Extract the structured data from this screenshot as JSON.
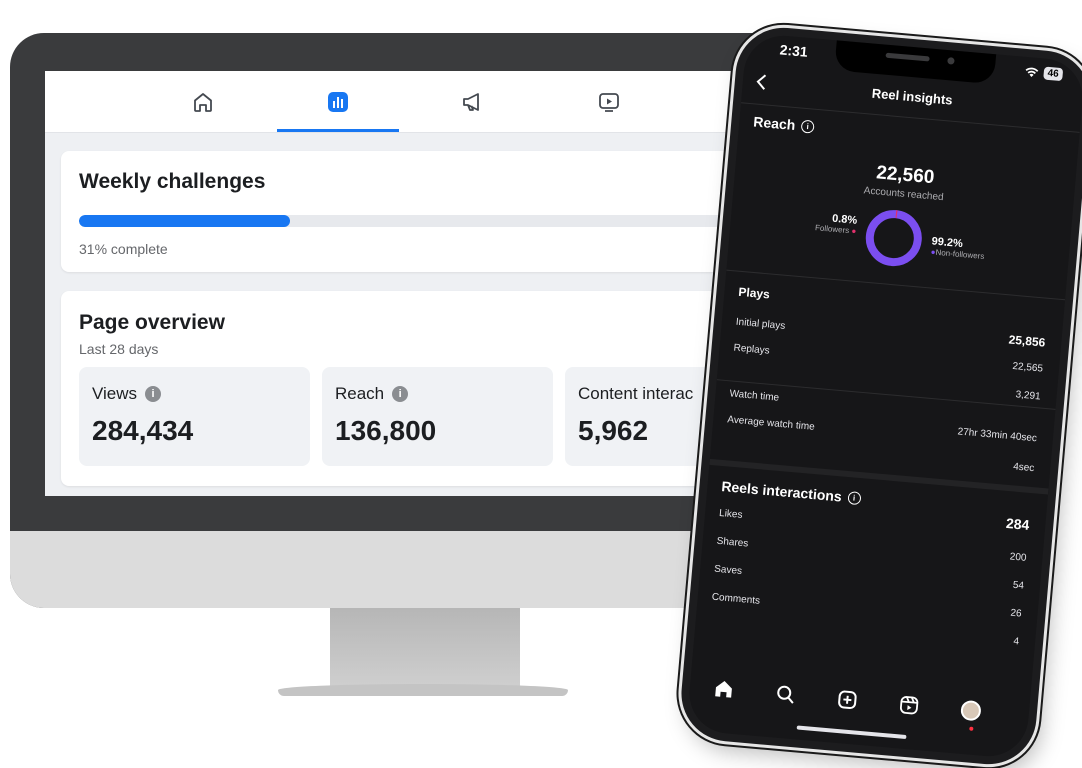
{
  "desktop": {
    "nav_tabs": [
      {
        "icon": "home-icon"
      },
      {
        "icon": "insights-bar-chart-icon",
        "active": true
      },
      {
        "icon": "megaphone-icon"
      },
      {
        "icon": "video-play-icon"
      }
    ],
    "weekly_challenges": {
      "title": "Weekly challenges",
      "progress": 0.31,
      "status": "31% complete"
    },
    "page_overview": {
      "title": "Page overview",
      "period": "Last 28 days",
      "metrics": [
        {
          "label": "Views",
          "value": "284,434"
        },
        {
          "label": "Reach",
          "value": "136,800"
        },
        {
          "label": "Content interac",
          "value": "5,962"
        }
      ]
    },
    "colors": {
      "accent": "#1877f2"
    }
  },
  "phone": {
    "status_time": "2:31",
    "battery": "46",
    "header_title": "Reel insights",
    "reach": {
      "title": "Reach",
      "accounts_value": "22,560",
      "accounts_label": "Accounts reached",
      "followers_pct": "0.8%",
      "followers_label": "Followers",
      "followers_share": 0.008,
      "nonfollowers_pct": "99.2%",
      "nonfollowers_label": "Non-followers",
      "colors": {
        "followers": "#e1306c",
        "nonfollowers": "#7b4ef0"
      }
    },
    "plays": {
      "title": "Plays",
      "total": "25,856",
      "rows": [
        {
          "label": "Initial plays",
          "value": "22,565"
        },
        {
          "label": "Replays",
          "value": "3,291"
        }
      ]
    },
    "watch": {
      "watch_time_label": "Watch time",
      "watch_time_value": "27hr 33min 40sec",
      "avg_label": "Average watch time",
      "avg_value": "4sec"
    },
    "interactions": {
      "title": "Reels interactions",
      "total": "284",
      "rows": [
        {
          "label": "Likes",
          "value": "200"
        },
        {
          "label": "Shares",
          "value": "54"
        },
        {
          "label": "Saves",
          "value": "26"
        },
        {
          "label": "Comments",
          "value": "4"
        }
      ]
    },
    "tabbar": [
      "home-icon",
      "search-icon",
      "create-icon",
      "reels-icon",
      "profile-avatar"
    ]
  }
}
